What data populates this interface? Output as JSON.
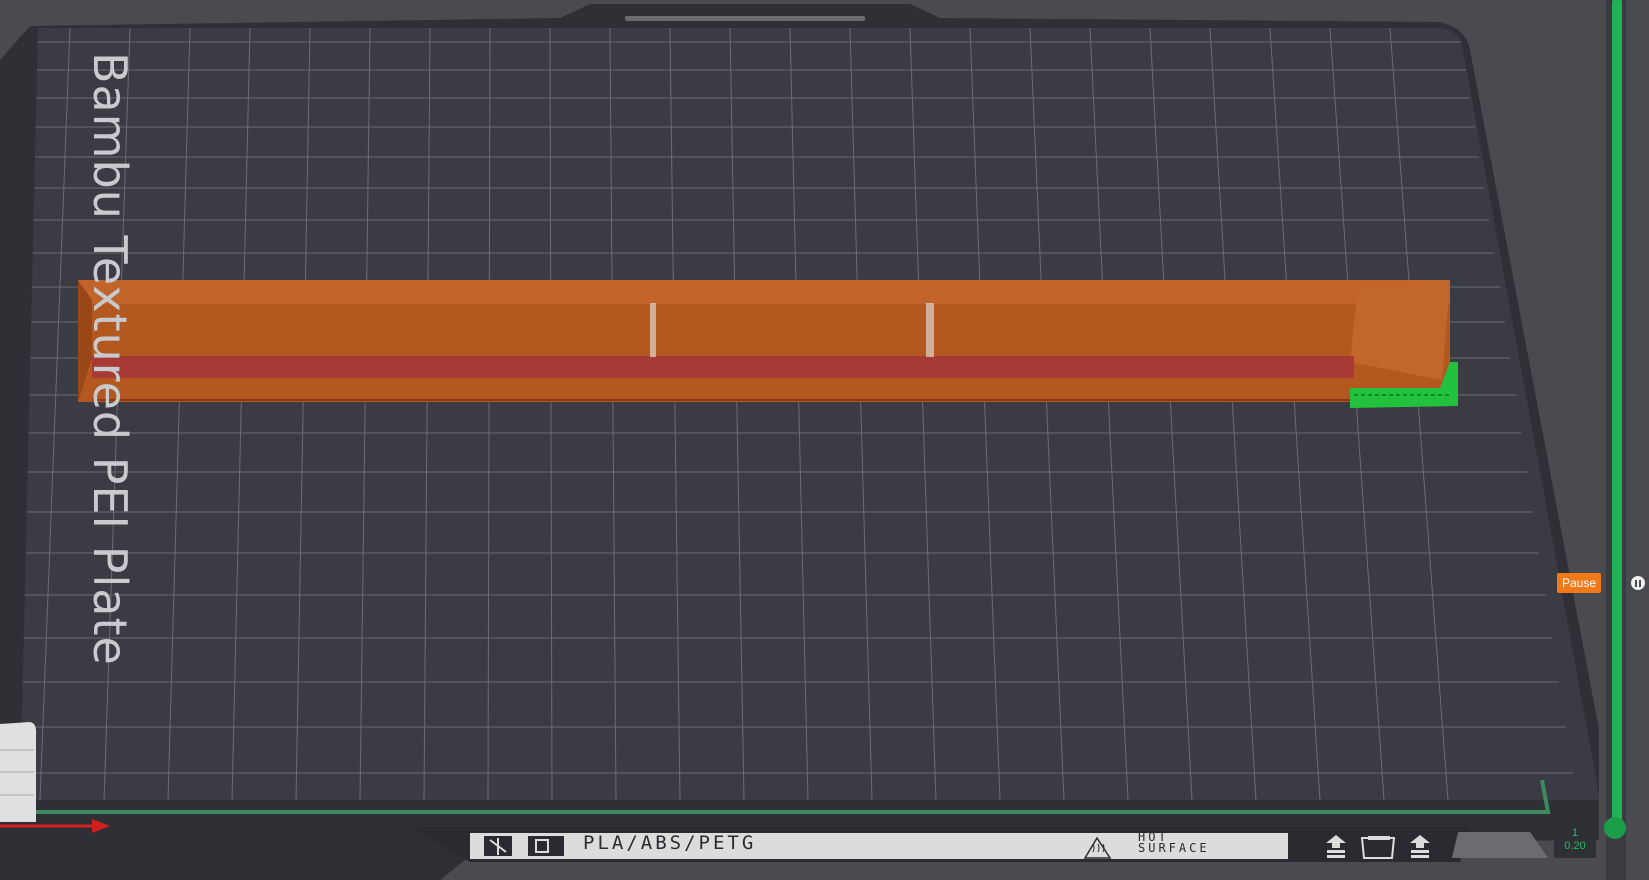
{
  "plate": {
    "name": "Bambu Textured PEI Plate",
    "material_label": "PLA/ABS/PETG",
    "warning_label": [
      "HOT",
      "SURFACE"
    ]
  },
  "layer_slider": {
    "pause_label": "Pause",
    "current_layer": "1",
    "current_height": "0.20"
  },
  "colors": {
    "background": "#4a4b50",
    "plate": "#3b3c43",
    "grid": "#6b6c73",
    "model": "#b3581f",
    "first_layer": "#a83a36",
    "brim": "#22c23f",
    "slider_track": "#20b355",
    "pause": "#f27a1b"
  },
  "icons": [
    "arrow-up-icon",
    "plate-outline-icon",
    "arrow-up-icon"
  ]
}
